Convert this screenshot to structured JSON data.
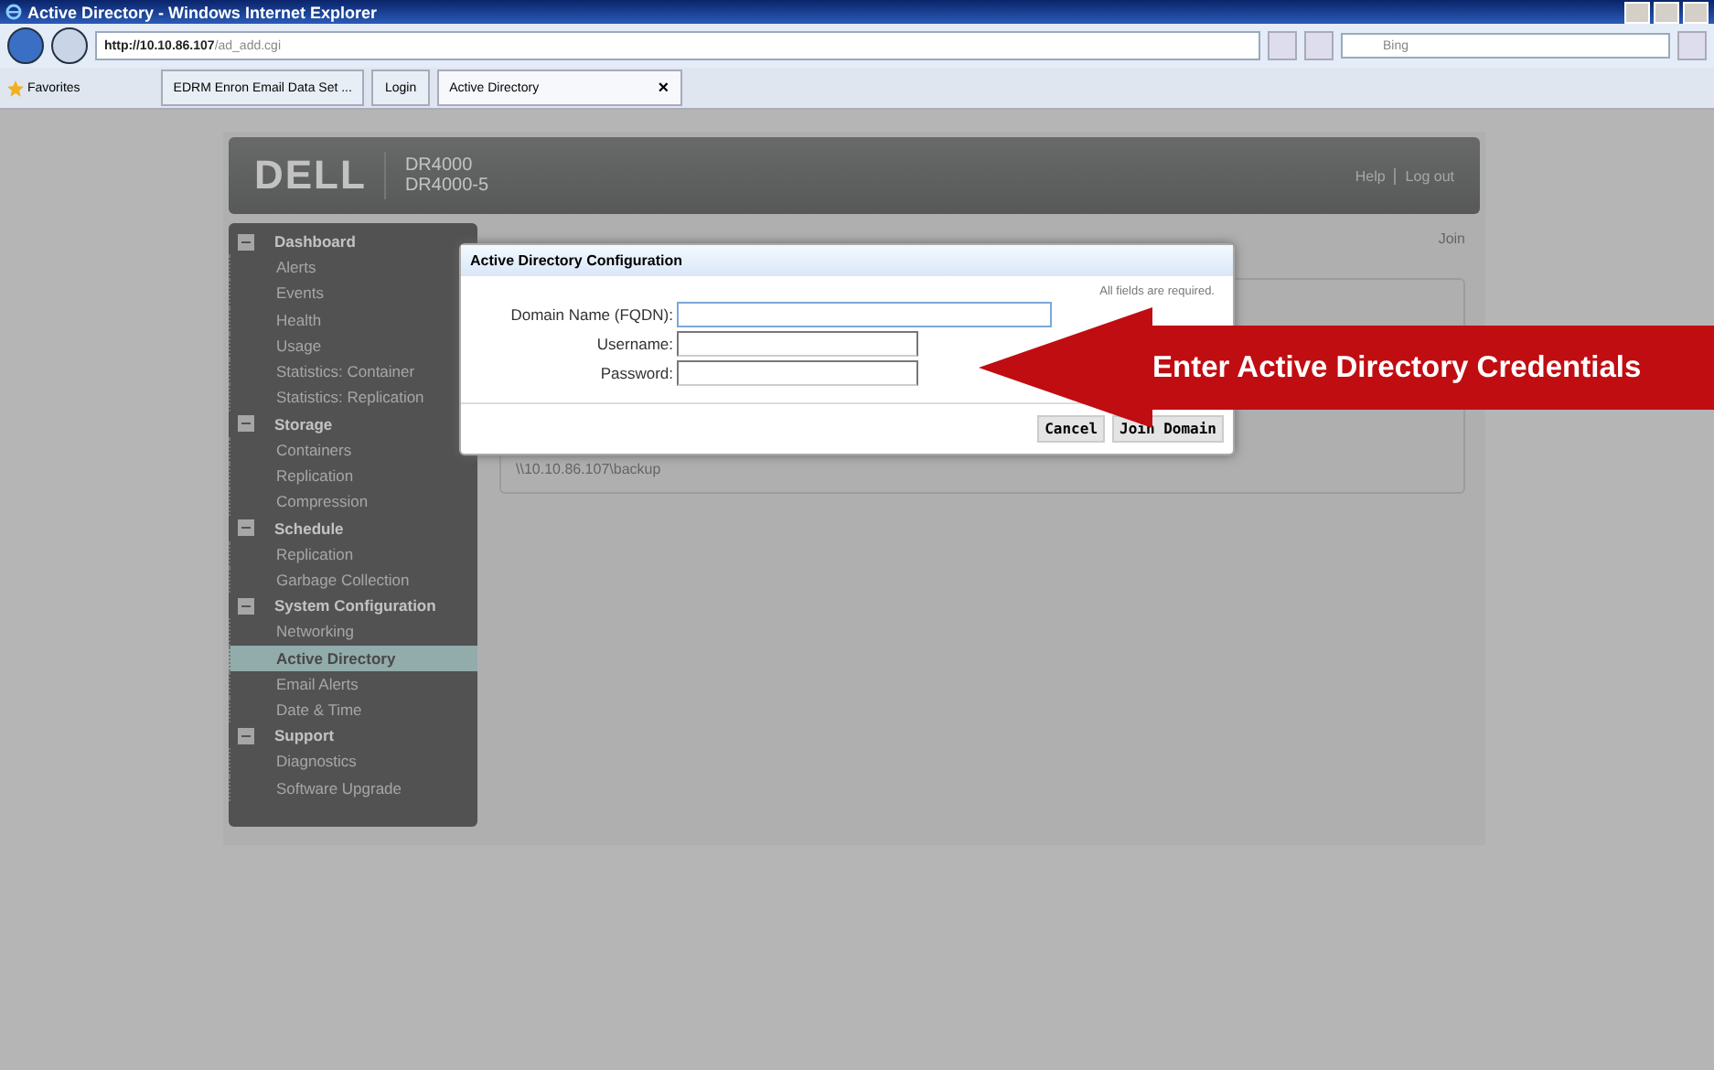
{
  "window": {
    "title": "Active Directory - Windows Internet Explorer"
  },
  "address_bar": {
    "url_host": "http://10.10.86.107",
    "url_path": "/ad_add.cgi"
  },
  "search": {
    "value": "Bing"
  },
  "favorites": {
    "label": "Favorites"
  },
  "tabs": [
    {
      "label": "EDRM Enron Email Data Set ...",
      "selected": false
    },
    {
      "label": "Login",
      "selected": false
    },
    {
      "label": "Active Directory",
      "selected": true,
      "close": "×"
    }
  ],
  "header": {
    "logo": "DELL",
    "product": "DR4000",
    "host": "DR4000-5",
    "links": [
      "Help",
      "Log out"
    ]
  },
  "sidebar": {
    "groups": [
      {
        "label": "Dashboard",
        "expanded": true,
        "children": [
          {
            "label": "Alerts",
            "selected": false
          },
          {
            "label": "Events",
            "selected": false
          },
          {
            "label": "Health",
            "selected": false
          },
          {
            "label": "Usage",
            "selected": false
          },
          {
            "label": "Statistics: Container",
            "selected": false
          },
          {
            "label": "Statistics: Replication",
            "selected": false
          }
        ]
      },
      {
        "label": "Storage",
        "expanded": true,
        "children": [
          {
            "label": "Containers",
            "selected": false
          },
          {
            "label": "Replication",
            "selected": false
          },
          {
            "label": "Compression",
            "selected": false
          }
        ]
      },
      {
        "label": "Schedule",
        "expanded": true,
        "children": [
          {
            "label": "Replication",
            "selected": false
          },
          {
            "label": "Garbage Collection",
            "selected": false
          }
        ]
      },
      {
        "label": "System Configuration",
        "expanded": true,
        "children": [
          {
            "label": "Networking",
            "selected": false
          },
          {
            "label": "Active Directory",
            "selected": true
          },
          {
            "label": "Email Alerts",
            "selected": false
          },
          {
            "label": "Date & Time",
            "selected": false
          }
        ]
      },
      {
        "label": "Support",
        "expanded": true,
        "children": [
          {
            "label": "Diagnostics",
            "selected": false
          },
          {
            "label": "Software Upgrade",
            "selected": false
          }
        ]
      }
    ]
  },
  "content": {
    "join_link": "Join",
    "share_path": "\\\\10.10.86.107\\backup"
  },
  "dialog": {
    "title": "Active Directory Configuration",
    "note": "All fields are required.",
    "fields": [
      {
        "label": "Domain Name (FQDN):",
        "focused": true
      },
      {
        "label": "Username:",
        "focused": false
      },
      {
        "label": "Password:",
        "focused": false
      }
    ],
    "buttons": [
      "Cancel",
      "Join Domain"
    ]
  },
  "callout": {
    "text": "Enter Active Directory Credentials"
  }
}
